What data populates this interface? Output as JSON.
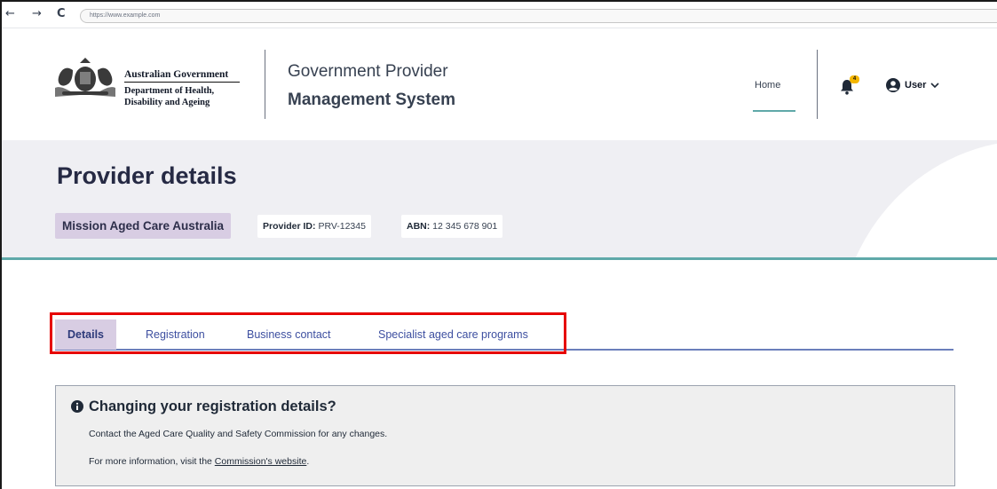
{
  "browser": {
    "back_glyph": "←",
    "forward_glyph": "→",
    "reload_glyph": "C",
    "url": "https://www.example.com"
  },
  "header": {
    "gov_title": "Australian Government",
    "gov_department": "Department of Health, Disability and Ageing",
    "system_title_line1": "Government Provider",
    "system_title_line2": "Management System",
    "nav_home": "Home",
    "notification_count": "4",
    "user_label": "User",
    "icons": [
      "crest-logo",
      "bell-icon",
      "user-circle-icon",
      "chevron-down-icon"
    ]
  },
  "hero": {
    "page_title": "Provider details",
    "provider_name": "Mission Aged Care Australia",
    "provider_id_label": "Provider ID:",
    "provider_id_value": "PRV-12345",
    "abn_label": "ABN:",
    "abn_value": "12 345 678 901"
  },
  "tabs": [
    {
      "label": "Details",
      "active": true
    },
    {
      "label": "Registration",
      "active": false
    },
    {
      "label": "Business contact",
      "active": false
    },
    {
      "label": "Specialist aged care programs",
      "active": false
    }
  ],
  "notice": {
    "icon": "info-icon",
    "title": "Changing your registration details?",
    "body": "Contact the Aged Care Quality and Safety Commission for any changes.",
    "more_prefix": "For more information, visit the ",
    "more_link": "Commission's website",
    "more_suffix": "."
  },
  "colors": {
    "accent_teal": "#5fa9a9",
    "chip_lavender": "#d8cde3",
    "tab_blue": "#3d4fa0",
    "highlight_red": "#e60000",
    "badge_yellow": "#f5b700"
  }
}
